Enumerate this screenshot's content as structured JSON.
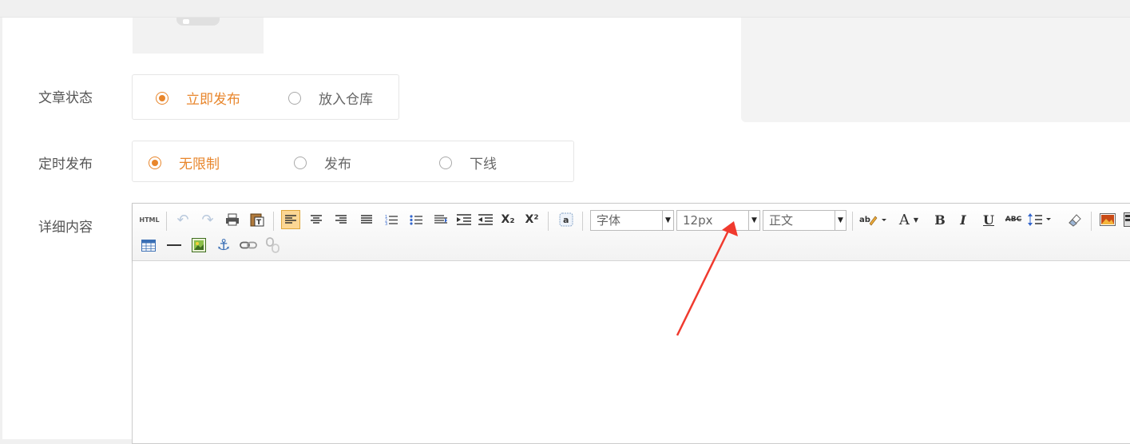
{
  "form": {
    "status": {
      "label": "文章状态",
      "options": [
        {
          "text": "立即发布",
          "selected": true
        },
        {
          "text": "放入仓库",
          "selected": false
        }
      ]
    },
    "schedule": {
      "label": "定时发布",
      "options": [
        {
          "text": "无限制",
          "selected": true
        },
        {
          "text": "发布",
          "selected": false
        },
        {
          "text": "下线",
          "selected": false
        }
      ]
    },
    "content": {
      "label": "详细内容"
    }
  },
  "toolbar": {
    "html_label": "HTML",
    "font_family": "字体",
    "font_size": "12px",
    "paragraph": "正文",
    "font_color_label": "A",
    "bold_label": "B",
    "italic_label": "I",
    "underline_label": "U",
    "strike_label": "ABC",
    "subscript_label": "X₂",
    "superscript_label": "X²"
  },
  "colors": {
    "accent": "#e8862c",
    "annotation_arrow": "#f03a2e"
  }
}
